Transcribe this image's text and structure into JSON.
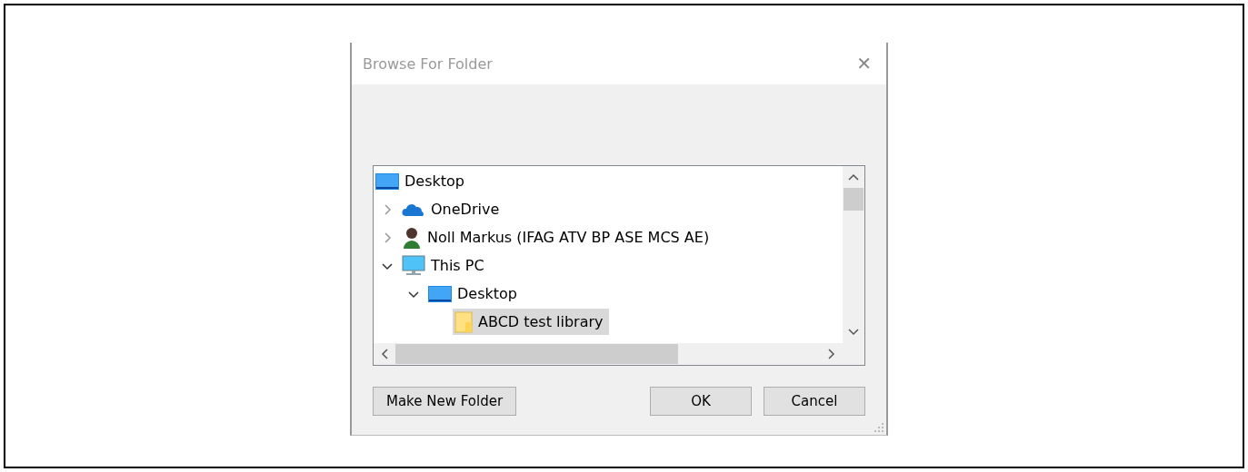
{
  "window": {
    "title": "Browse For Folder",
    "close": "✕"
  },
  "tree": [
    {
      "label": "Desktop",
      "kind": "desktop",
      "selected": false,
      "children": [
        {
          "label": "OneDrive",
          "kind": "cloud",
          "expanded": false,
          "selected": false
        },
        {
          "label": "Noll Markus (IFAG ATV BP ASE MCS AE)",
          "kind": "person",
          "expanded": false,
          "selected": false
        },
        {
          "label": "This PC",
          "kind": "pc",
          "expanded": true,
          "selected": false,
          "children": [
            {
              "label": "Desktop",
              "kind": "desktop",
              "expanded": true,
              "selected": false,
              "children": [
                {
                  "label": "ABCD test library",
                  "kind": "folder",
                  "selected": true
                }
              ]
            }
          ]
        }
      ]
    }
  ],
  "buttons": [
    {
      "label": "Make New Folder",
      "kind": "left"
    },
    {
      "label": "OK",
      "kind": "right"
    },
    {
      "label": "Cancel",
      "kind": "right"
    }
  ]
}
